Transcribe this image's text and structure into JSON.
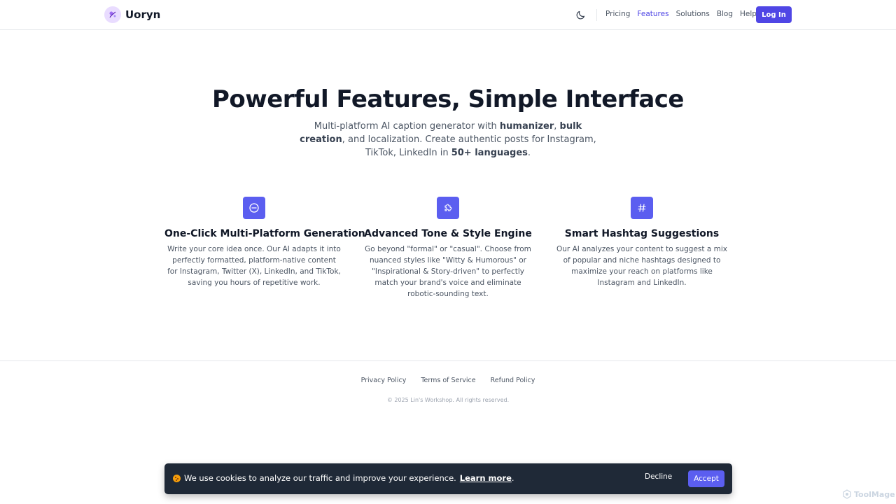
{
  "header": {
    "brand": "Uoryn",
    "nav": [
      {
        "label": "Pricing",
        "active": false
      },
      {
        "label": "Features",
        "active": true
      },
      {
        "label": "Solutions",
        "active": false
      },
      {
        "label": "Blog",
        "active": false
      },
      {
        "label": "Help",
        "active": false
      }
    ],
    "login_label": "Log In",
    "icons": {
      "logo": "brand-logo",
      "theme": "moon-icon"
    }
  },
  "hero": {
    "title": "Powerful Features, Simple Interface",
    "subtitle_parts": [
      "Multi-platform AI caption generator with ",
      "humanizer",
      ", ",
      "bulk creation",
      ", and localization. Create authentic posts for Instagram, TikTok, LinkedIn in ",
      "50+ languages",
      "."
    ]
  },
  "features": [
    {
      "icon": "minus-circle-icon",
      "title": "One-Click Multi-Platform Generation",
      "description": "Write your core idea once. Our AI adapts it into perfectly formatted, platform-native content for Instagram, Twitter (X), LinkedIn, and TikTok, saving you hours of repetitive work."
    },
    {
      "icon": "puzzle-icon",
      "title": "Advanced Tone & Style Engine",
      "description": "Go beyond \"formal\" or \"casual\". Choose from nuanced styles like \"Witty & Humorous\" or \"Inspirational & Story-driven\" to perfectly match your brand's voice and eliminate robotic-sounding text."
    },
    {
      "icon": "hashtag-icon",
      "title": "Smart Hashtag Suggestions",
      "description": "Our AI analyzes your content to suggest a mix of popular and niche hashtags designed to maximize your reach on platforms like Instagram and LinkedIn."
    }
  ],
  "footer": {
    "links": [
      "Privacy Policy",
      "Terms of Service",
      "Refund Policy"
    ],
    "copyright": "© 2025 Lin's Workshop. All rights reserved."
  },
  "cookie": {
    "text": "We use cookies to analyze our traffic and improve your experience.",
    "link": "Learn more",
    "link_suffix": ".",
    "decline_label": "Decline",
    "accept_label": "Accept",
    "icon": "cookie-icon"
  },
  "watermark": "ToolMage",
  "colors": {
    "accent": "#4f46e5",
    "feature_icon_bg": "#5b5ef0",
    "banner_bg": "#1f2937"
  }
}
